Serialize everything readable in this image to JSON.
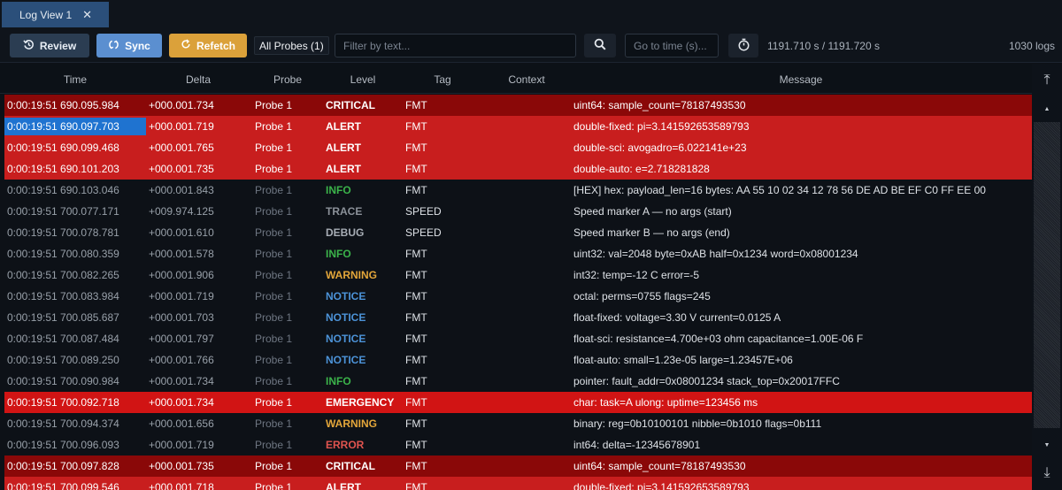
{
  "tab": {
    "title": "Log View 1",
    "close_glyph": "✕"
  },
  "toolbar": {
    "review_label": "Review",
    "sync_label": "Sync",
    "refetch_label": "Refetch",
    "probes_label": "All Probes (1)",
    "filter_placeholder": "Filter by text...",
    "goto_placeholder": "Go to time (s)...",
    "time_range": "1191.710 s / 1191.720 s",
    "log_count": "1030 logs"
  },
  "columns": [
    "Time",
    "Delta",
    "Probe",
    "Level",
    "Tag",
    "Context",
    "Message"
  ],
  "level_colors": {
    "INFO": "#3bb34a",
    "TRACE": "#8b9199",
    "DEBUG": "#a7adb5",
    "WARNING": "#e3a63a",
    "NOTICE": "#4c93d8",
    "ERROR": "#e0544f"
  },
  "rows": [
    {
      "time": "0:00:19:51 690.095.984",
      "delta": "+000.001.734",
      "probe": "Probe 1",
      "level": "CRITICAL",
      "tag": "FMT",
      "context": "",
      "message": "uint64: sample_count=78187493530"
    },
    {
      "time": "0:00:19:51 690.097.703",
      "delta": "+000.001.719",
      "probe": "Probe 1",
      "level": "ALERT",
      "tag": "FMT",
      "context": "",
      "message": "double-fixed: pi=3.141592653589793",
      "selected_time": true
    },
    {
      "time": "0:00:19:51 690.099.468",
      "delta": "+000.001.765",
      "probe": "Probe 1",
      "level": "ALERT",
      "tag": "FMT",
      "context": "",
      "message": "double-sci: avogadro=6.022141e+23"
    },
    {
      "time": "0:00:19:51 690.101.203",
      "delta": "+000.001.735",
      "probe": "Probe 1",
      "level": "ALERT",
      "tag": "FMT",
      "context": "",
      "message": "double-auto: e=2.718281828"
    },
    {
      "time": "0:00:19:51 690.103.046",
      "delta": "+000.001.843",
      "probe": "Probe 1",
      "level": "INFO",
      "tag": "FMT",
      "context": "",
      "message": "[HEX] hex: payload_len=16 bytes: AA 55 10 02 34 12 78 56 DE AD BE EF C0 FF EE 00"
    },
    {
      "time": "0:00:19:51 700.077.171",
      "delta": "+009.974.125",
      "probe": "Probe 1",
      "level": "TRACE",
      "tag": "SPEED",
      "context": "",
      "message": "Speed marker A — no args (start)"
    },
    {
      "time": "0:00:19:51 700.078.781",
      "delta": "+000.001.610",
      "probe": "Probe 1",
      "level": "DEBUG",
      "tag": "SPEED",
      "context": "",
      "message": "Speed marker B — no args (end)"
    },
    {
      "time": "0:00:19:51 700.080.359",
      "delta": "+000.001.578",
      "probe": "Probe 1",
      "level": "INFO",
      "tag": "FMT",
      "context": "",
      "message": "uint32: val=2048  byte=0xAB  half=0x1234  word=0x08001234"
    },
    {
      "time": "0:00:19:51 700.082.265",
      "delta": "+000.001.906",
      "probe": "Probe 1",
      "level": "WARNING",
      "tag": "FMT",
      "context": "",
      "message": "int32: temp=-12 C  error=-5"
    },
    {
      "time": "0:00:19:51 700.083.984",
      "delta": "+000.001.719",
      "probe": "Probe 1",
      "level": "NOTICE",
      "tag": "FMT",
      "context": "",
      "message": "octal: perms=0755  flags=245"
    },
    {
      "time": "0:00:19:51 700.085.687",
      "delta": "+000.001.703",
      "probe": "Probe 1",
      "level": "NOTICE",
      "tag": "FMT",
      "context": "",
      "message": "float-fixed: voltage=3.30 V  current=0.0125 A"
    },
    {
      "time": "0:00:19:51 700.087.484",
      "delta": "+000.001.797",
      "probe": "Probe 1",
      "level": "NOTICE",
      "tag": "FMT",
      "context": "",
      "message": "float-sci: resistance=4.700e+03 ohm  capacitance=1.00E-06 F"
    },
    {
      "time": "0:00:19:51 700.089.250",
      "delta": "+000.001.766",
      "probe": "Probe 1",
      "level": "NOTICE",
      "tag": "FMT",
      "context": "",
      "message": "float-auto: small=1.23e-05  large=1.23457E+06"
    },
    {
      "time": "0:00:19:51 700.090.984",
      "delta": "+000.001.734",
      "probe": "Probe 1",
      "level": "INFO",
      "tag": "FMT",
      "context": "",
      "message": "pointer: fault_addr=0x08001234  stack_top=0x20017FFC"
    },
    {
      "time": "0:00:19:51 700.092.718",
      "delta": "+000.001.734",
      "probe": "Probe 1",
      "level": "EMERGENCY",
      "tag": "FMT",
      "context": "",
      "message": "char: task=A  ulong: uptime=123456 ms"
    },
    {
      "time": "0:00:19:51 700.094.374",
      "delta": "+000.001.656",
      "probe": "Probe 1",
      "level": "WARNING",
      "tag": "FMT",
      "context": "",
      "message": "binary: reg=0b10100101  nibble=0b1010  flags=0b111"
    },
    {
      "time": "0:00:19:51 700.096.093",
      "delta": "+000.001.719",
      "probe": "Probe 1",
      "level": "ERROR",
      "tag": "FMT",
      "context": "",
      "message": "int64: delta=-12345678901"
    },
    {
      "time": "0:00:19:51 700.097.828",
      "delta": "+000.001.735",
      "probe": "Probe 1",
      "level": "CRITICAL",
      "tag": "FMT",
      "context": "",
      "message": "uint64: sample_count=78187493530"
    },
    {
      "time": "0:00:19:51 700.099.546",
      "delta": "+000.001.718",
      "probe": "Probe 1",
      "level": "ALERT",
      "tag": "FMT",
      "context": "",
      "message": "double-fixed: pi=3.141592653589793"
    }
  ],
  "scrollbar": {
    "top_glyph": "⤒",
    "up_glyph": "▲",
    "down_glyph": "▼",
    "bottom_glyph": "⤓"
  }
}
